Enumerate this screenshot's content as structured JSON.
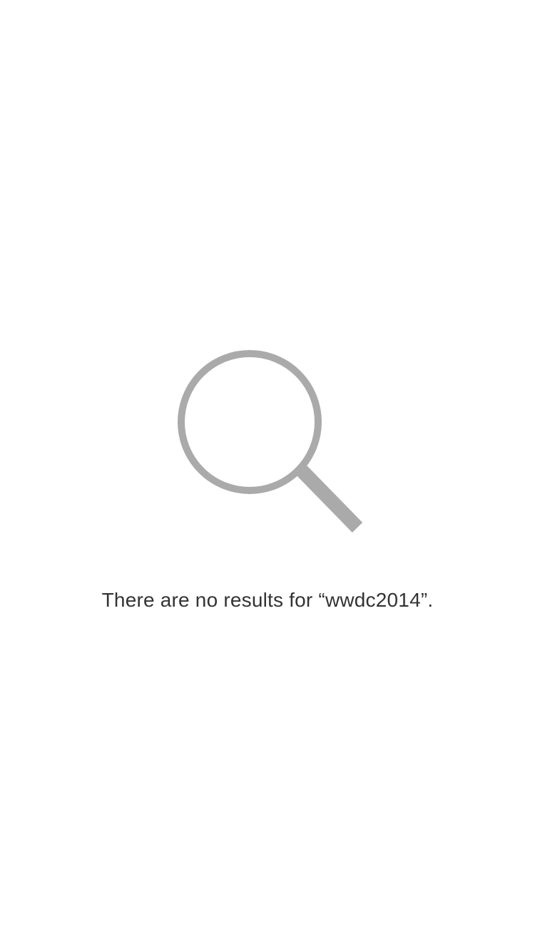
{
  "empty_state": {
    "icon": "magnifying-glass-icon",
    "icon_color": "#aaaaaa",
    "message": "There are no results for “wwdc2014”."
  }
}
